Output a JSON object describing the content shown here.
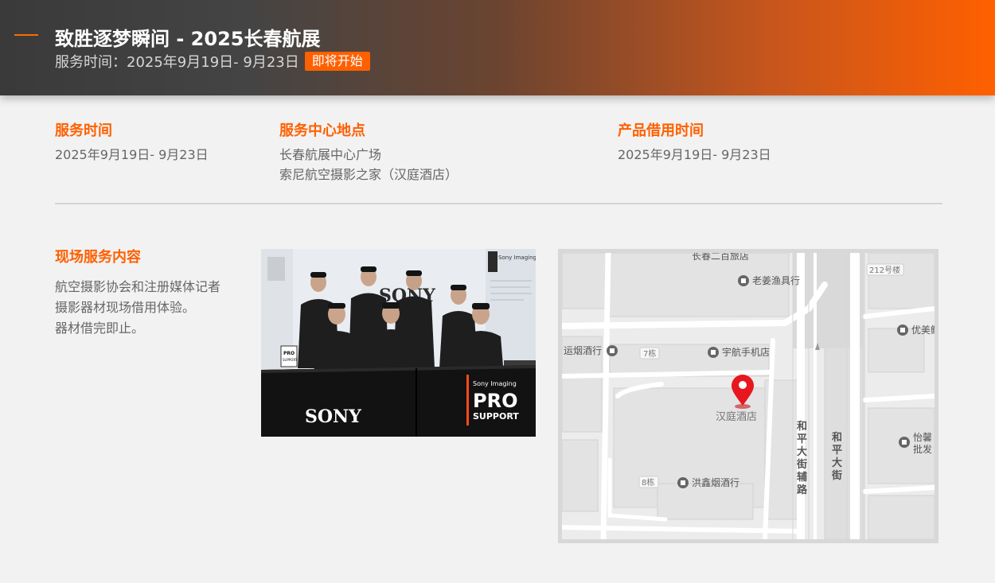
{
  "header": {
    "title": "致胜逐梦瞬间 - 2025长春航展",
    "service_time": "服务时间：2025年9月19日- 9月23日",
    "status_badge": "即将开始"
  },
  "info": {
    "time": {
      "label": "服务时间",
      "value": "2025年9月19日- 9月23日"
    },
    "location": {
      "label": "服务中心地点",
      "line1": "长春航展中心广场",
      "line2": "索尼航空摄影之家（汉庭酒店）"
    },
    "loan": {
      "label": "产品借用时间",
      "value": "2025年9月19日- 9月23日"
    }
  },
  "services": {
    "title": "现场服务内容",
    "lines": [
      "航空摄影协会和注册媒体记者",
      "摄影器材现场借用体验。",
      "器材借完即止。"
    ]
  },
  "photo": {
    "wall_brand": "SONY",
    "wall_panel": "Sony Imaging 影像专业服务",
    "table_brand": "SONY",
    "banner_line1": "Sony Imaging",
    "banner_line2": "PRO",
    "banner_line3": "SUPPORT",
    "sign_line1": "PRO",
    "sign_line2": "SUPPORT"
  },
  "map": {
    "pois": {
      "top_cut": "长春二百旅店",
      "fishing": "老姜渔具行",
      "building_212": "212号楼",
      "youmei": "优美鲜",
      "tobacco_left": "运烟酒行",
      "building_7": "7栋",
      "yuhang": "宇航手机店",
      "hotel": "汉庭酒店",
      "yixin": "怡馨",
      "yixin2": "批发",
      "building_8": "8栋",
      "hongxin": "洪鑫烟酒行"
    },
    "roads": {
      "side_road": [
        "和",
        "平",
        "大",
        "街",
        "辅",
        "路"
      ],
      "main_road": [
        "和",
        "平",
        "大",
        "街"
      ]
    },
    "accent": "#e8161f"
  },
  "colors": {
    "accent": "#ff6000"
  }
}
